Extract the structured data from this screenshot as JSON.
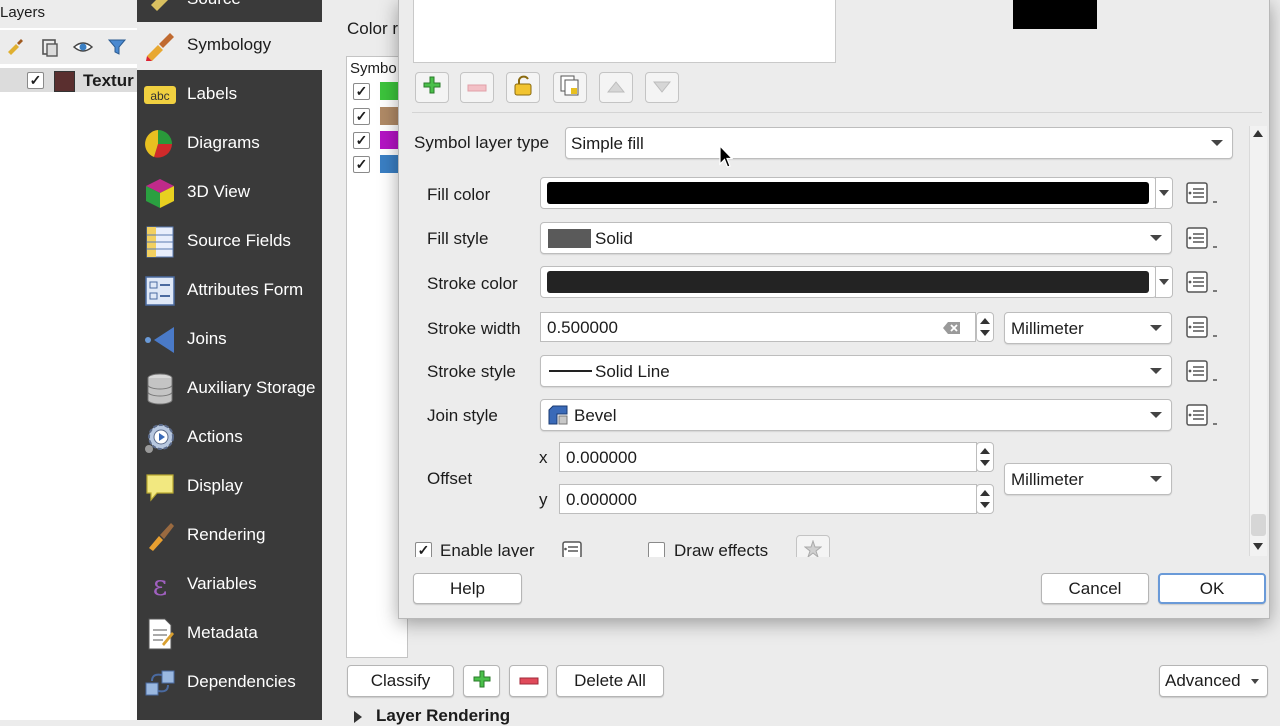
{
  "layers_panel": {
    "title": "Layers",
    "layer": {
      "name": "Textur",
      "checked": "✓",
      "swatch_color": "#5a2f2f"
    }
  },
  "nav": {
    "items": [
      {
        "label": "Source",
        "icon": "source-icon"
      },
      {
        "label": "Symbology",
        "icon": "symbology-icon",
        "selected": true
      },
      {
        "label": "Labels",
        "icon": "labels-abc-icon"
      },
      {
        "label": "Diagrams",
        "icon": "diagrams-icon"
      },
      {
        "label": "3D View",
        "icon": "cube-3d-icon"
      },
      {
        "label": "Source Fields",
        "icon": "source-fields-icon"
      },
      {
        "label": "Attributes Form",
        "icon": "attributes-form-icon"
      },
      {
        "label": "Joins",
        "icon": "joins-icon"
      },
      {
        "label": "Auxiliary Storage",
        "icon": "database-icon"
      },
      {
        "label": "Actions",
        "icon": "actions-gear-icon"
      },
      {
        "label": "Display",
        "icon": "display-bubble-icon"
      },
      {
        "label": "Rendering",
        "icon": "rendering-brush-icon"
      },
      {
        "label": "Variables",
        "icon": "variables-epsilon-icon"
      },
      {
        "label": "Metadata",
        "icon": "metadata-doc-icon"
      },
      {
        "label": "Dependencies",
        "icon": "dependencies-icon"
      }
    ]
  },
  "main": {
    "color_label": "Color r",
    "symbol_header": "Symbo",
    "symbol_swatches": [
      "#3cc43c",
      "#b08a66",
      "#b414c4",
      "#3a7fc4"
    ],
    "classify_button": "Classify",
    "delete_all_button": "Delete All",
    "advanced_button": "Advanced",
    "layer_rendering_label": "Layer Rendering"
  },
  "dialog": {
    "symbol_layer_type_label": "Symbol layer type",
    "symbol_layer_type_value": "Simple fill",
    "fill_color_label": "Fill color",
    "fill_color": "#000000",
    "fill_style_label": "Fill style",
    "fill_style_value": "Solid",
    "stroke_color_label": "Stroke color",
    "stroke_color": "#232323",
    "stroke_width_label": "Stroke width",
    "stroke_width_value": "0.500000",
    "stroke_width_unit": "Millimeter",
    "stroke_style_label": "Stroke style",
    "stroke_style_value": "Solid Line",
    "join_style_label": "Join style",
    "join_style_value": "Bevel",
    "offset_label": "Offset",
    "offset_x_label": "x",
    "offset_x_value": "0.000000",
    "offset_y_label": "y",
    "offset_y_value": "0.000000",
    "offset_unit": "Millimeter",
    "enable_layer_label": "Enable layer",
    "draw_effects_label": "Draw effects",
    "help_button": "Help",
    "cancel_button": "Cancel",
    "ok_button": "OK"
  }
}
